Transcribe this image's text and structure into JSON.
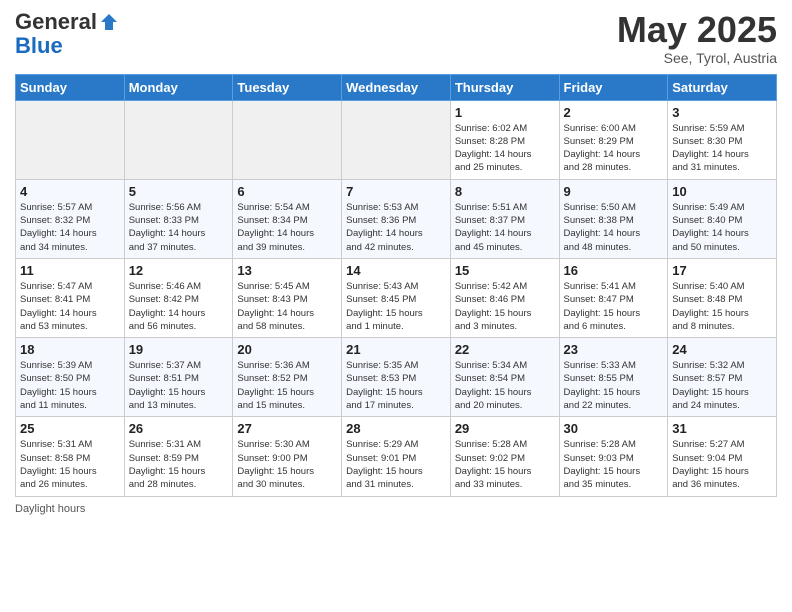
{
  "logo": {
    "general": "General",
    "blue": "Blue"
  },
  "header": {
    "month": "May 2025",
    "location": "See, Tyrol, Austria"
  },
  "days_of_week": [
    "Sunday",
    "Monday",
    "Tuesday",
    "Wednesday",
    "Thursday",
    "Friday",
    "Saturday"
  ],
  "weeks": [
    [
      {
        "day": "",
        "info": ""
      },
      {
        "day": "",
        "info": ""
      },
      {
        "day": "",
        "info": ""
      },
      {
        "day": "",
        "info": ""
      },
      {
        "day": "1",
        "info": "Sunrise: 6:02 AM\nSunset: 8:28 PM\nDaylight: 14 hours\nand 25 minutes."
      },
      {
        "day": "2",
        "info": "Sunrise: 6:00 AM\nSunset: 8:29 PM\nDaylight: 14 hours\nand 28 minutes."
      },
      {
        "day": "3",
        "info": "Sunrise: 5:59 AM\nSunset: 8:30 PM\nDaylight: 14 hours\nand 31 minutes."
      }
    ],
    [
      {
        "day": "4",
        "info": "Sunrise: 5:57 AM\nSunset: 8:32 PM\nDaylight: 14 hours\nand 34 minutes."
      },
      {
        "day": "5",
        "info": "Sunrise: 5:56 AM\nSunset: 8:33 PM\nDaylight: 14 hours\nand 37 minutes."
      },
      {
        "day": "6",
        "info": "Sunrise: 5:54 AM\nSunset: 8:34 PM\nDaylight: 14 hours\nand 39 minutes."
      },
      {
        "day": "7",
        "info": "Sunrise: 5:53 AM\nSunset: 8:36 PM\nDaylight: 14 hours\nand 42 minutes."
      },
      {
        "day": "8",
        "info": "Sunrise: 5:51 AM\nSunset: 8:37 PM\nDaylight: 14 hours\nand 45 minutes."
      },
      {
        "day": "9",
        "info": "Sunrise: 5:50 AM\nSunset: 8:38 PM\nDaylight: 14 hours\nand 48 minutes."
      },
      {
        "day": "10",
        "info": "Sunrise: 5:49 AM\nSunset: 8:40 PM\nDaylight: 14 hours\nand 50 minutes."
      }
    ],
    [
      {
        "day": "11",
        "info": "Sunrise: 5:47 AM\nSunset: 8:41 PM\nDaylight: 14 hours\nand 53 minutes."
      },
      {
        "day": "12",
        "info": "Sunrise: 5:46 AM\nSunset: 8:42 PM\nDaylight: 14 hours\nand 56 minutes."
      },
      {
        "day": "13",
        "info": "Sunrise: 5:45 AM\nSunset: 8:43 PM\nDaylight: 14 hours\nand 58 minutes."
      },
      {
        "day": "14",
        "info": "Sunrise: 5:43 AM\nSunset: 8:45 PM\nDaylight: 15 hours\nand 1 minute."
      },
      {
        "day": "15",
        "info": "Sunrise: 5:42 AM\nSunset: 8:46 PM\nDaylight: 15 hours\nand 3 minutes."
      },
      {
        "day": "16",
        "info": "Sunrise: 5:41 AM\nSunset: 8:47 PM\nDaylight: 15 hours\nand 6 minutes."
      },
      {
        "day": "17",
        "info": "Sunrise: 5:40 AM\nSunset: 8:48 PM\nDaylight: 15 hours\nand 8 minutes."
      }
    ],
    [
      {
        "day": "18",
        "info": "Sunrise: 5:39 AM\nSunset: 8:50 PM\nDaylight: 15 hours\nand 11 minutes."
      },
      {
        "day": "19",
        "info": "Sunrise: 5:37 AM\nSunset: 8:51 PM\nDaylight: 15 hours\nand 13 minutes."
      },
      {
        "day": "20",
        "info": "Sunrise: 5:36 AM\nSunset: 8:52 PM\nDaylight: 15 hours\nand 15 minutes."
      },
      {
        "day": "21",
        "info": "Sunrise: 5:35 AM\nSunset: 8:53 PM\nDaylight: 15 hours\nand 17 minutes."
      },
      {
        "day": "22",
        "info": "Sunrise: 5:34 AM\nSunset: 8:54 PM\nDaylight: 15 hours\nand 20 minutes."
      },
      {
        "day": "23",
        "info": "Sunrise: 5:33 AM\nSunset: 8:55 PM\nDaylight: 15 hours\nand 22 minutes."
      },
      {
        "day": "24",
        "info": "Sunrise: 5:32 AM\nSunset: 8:57 PM\nDaylight: 15 hours\nand 24 minutes."
      }
    ],
    [
      {
        "day": "25",
        "info": "Sunrise: 5:31 AM\nSunset: 8:58 PM\nDaylight: 15 hours\nand 26 minutes."
      },
      {
        "day": "26",
        "info": "Sunrise: 5:31 AM\nSunset: 8:59 PM\nDaylight: 15 hours\nand 28 minutes."
      },
      {
        "day": "27",
        "info": "Sunrise: 5:30 AM\nSunset: 9:00 PM\nDaylight: 15 hours\nand 30 minutes."
      },
      {
        "day": "28",
        "info": "Sunrise: 5:29 AM\nSunset: 9:01 PM\nDaylight: 15 hours\nand 31 minutes."
      },
      {
        "day": "29",
        "info": "Sunrise: 5:28 AM\nSunset: 9:02 PM\nDaylight: 15 hours\nand 33 minutes."
      },
      {
        "day": "30",
        "info": "Sunrise: 5:28 AM\nSunset: 9:03 PM\nDaylight: 15 hours\nand 35 minutes."
      },
      {
        "day": "31",
        "info": "Sunrise: 5:27 AM\nSunset: 9:04 PM\nDaylight: 15 hours\nand 36 minutes."
      }
    ]
  ],
  "footer": {
    "daylight_hours": "Daylight hours"
  }
}
